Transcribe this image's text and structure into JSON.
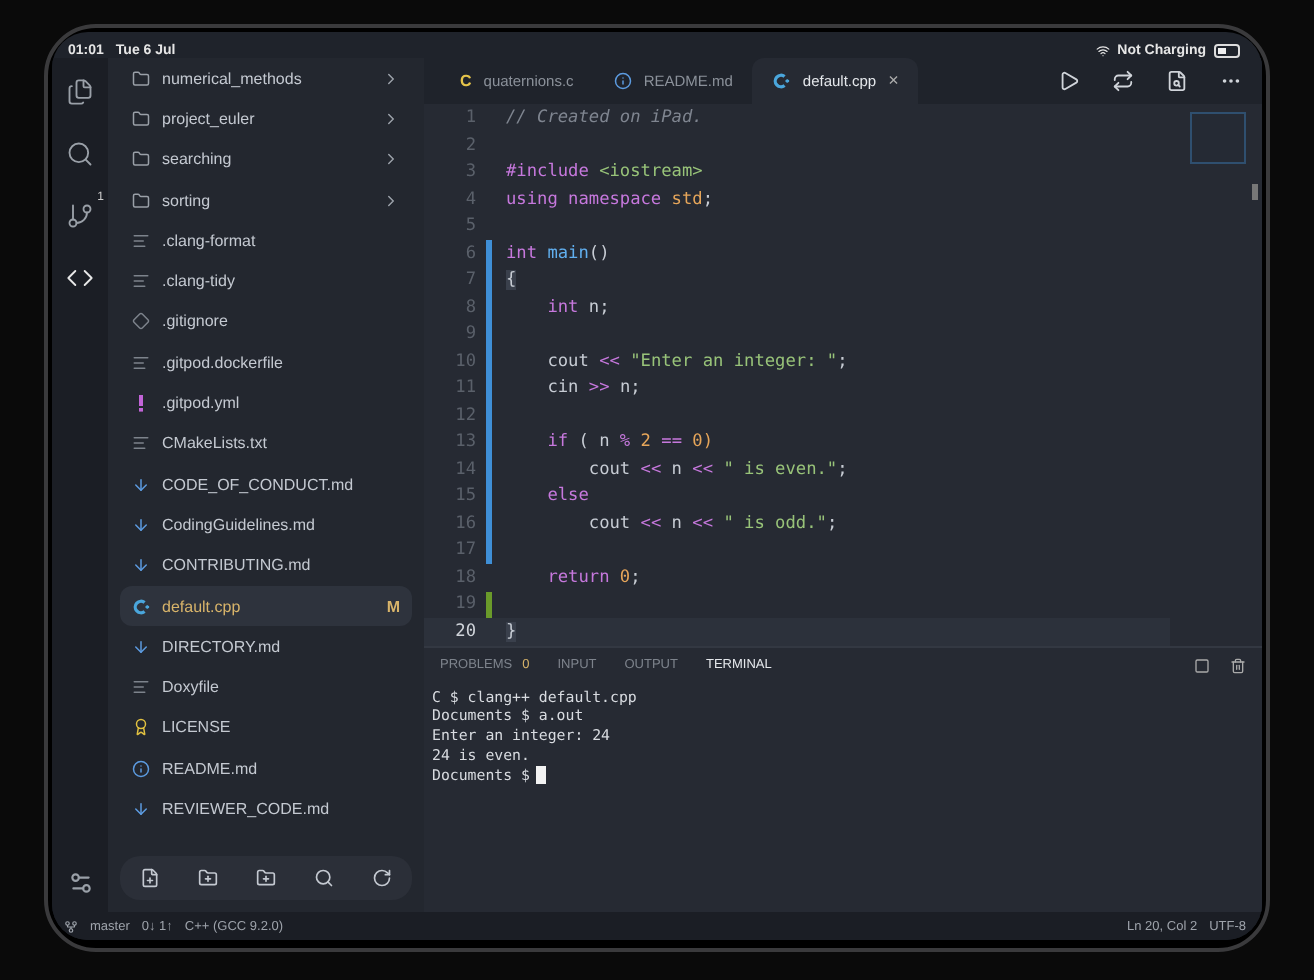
{
  "status_bar_top": {
    "time": "01:01",
    "date": "Tue 6 Jul",
    "battery_text": "Not Charging"
  },
  "activity_bar": {
    "items": [
      {
        "selected": false
      },
      {
        "selected": false
      },
      {
        "selected": false,
        "badge": "1"
      },
      {
        "selected": true
      }
    ]
  },
  "sidebar": {
    "items": [
      {
        "name": "numerical_methods",
        "kind": "folder"
      },
      {
        "name": "project_euler",
        "kind": "folder"
      },
      {
        "name": "searching",
        "kind": "folder"
      },
      {
        "name": "sorting",
        "kind": "folder"
      },
      {
        "name": ".clang-format",
        "kind": "text",
        "selected": false
      },
      {
        "name": ".clang-tidy",
        "kind": "text",
        "selected": false
      },
      {
        "name": ".gitignore",
        "kind": "git",
        "selected": false
      },
      {
        "name": ".gitpod.dockerfile",
        "kind": "text",
        "selected": false
      },
      {
        "name": ".gitpod.yml",
        "kind": "yaml",
        "selected": false
      },
      {
        "name": "CMakeLists.txt",
        "kind": "text",
        "selected": false
      },
      {
        "name": "CODE_OF_CONDUCT.md",
        "kind": "markdown",
        "selected": false
      },
      {
        "name": "CodingGuidelines.md",
        "kind": "markdown",
        "selected": false
      },
      {
        "name": "CONTRIBUTING.md",
        "kind": "markdown",
        "selected": false
      },
      {
        "name": "default.cpp",
        "kind": "cpp",
        "selected": true,
        "badge": "M"
      },
      {
        "name": "DIRECTORY.md",
        "kind": "markdown",
        "selected": false
      },
      {
        "name": "Doxyfile",
        "kind": "text",
        "selected": false
      },
      {
        "name": "LICENSE",
        "kind": "license",
        "selected": false
      },
      {
        "name": "README.md",
        "kind": "info",
        "selected": false
      },
      {
        "name": "REVIEWER_CODE.md",
        "kind": "markdown",
        "selected": false
      }
    ]
  },
  "editor_tabs": [
    {
      "label": "quaternions.c",
      "kind": "c",
      "icon_text": "C",
      "selected": false
    },
    {
      "label": "README.md",
      "kind": "info",
      "selected": false
    },
    {
      "label": "default.cpp",
      "kind": "cpp",
      "selected": true,
      "close": "×"
    }
  ],
  "code_lines": [
    {
      "number": "1",
      "modified": false,
      "added": false,
      "current": false,
      "tokens": [
        {
          "text": "// Created on iPad.",
          "kind": "comment"
        }
      ]
    },
    {
      "number": "2",
      "modified": false,
      "added": false,
      "current": false
    },
    {
      "number": "3",
      "modified": false,
      "added": false,
      "current": false,
      "tokens": [
        {
          "text": "#include ",
          "kind": "keyword"
        },
        {
          "text": "<iostream>",
          "kind": "string"
        }
      ]
    },
    {
      "number": "4",
      "modified": false,
      "added": false,
      "current": false,
      "tokens": [
        {
          "text": "using namespace ",
          "kind": "keyword"
        },
        {
          "text": "std",
          "kind": "type"
        },
        {
          "text": ";",
          "kind": "plain"
        }
      ]
    },
    {
      "number": "5",
      "modified": false,
      "added": false,
      "current": false
    },
    {
      "number": "6",
      "modified": true,
      "added": false,
      "current": false,
      "tokens": [
        {
          "text": "int ",
          "kind": "keyword"
        },
        {
          "text": "main",
          "kind": "func"
        },
        {
          "text": "()",
          "kind": "plain"
        }
      ]
    },
    {
      "number": "7",
      "modified": true,
      "added": false,
      "current": false,
      "tokens": [
        {
          "text": "{",
          "kind": "bracket"
        }
      ]
    },
    {
      "number": "8",
      "modified": true,
      "added": false,
      "current": false,
      "tokens": [
        {
          "text": "    int ",
          "kind": "keyword"
        },
        {
          "text": "n;",
          "kind": "plain"
        }
      ]
    },
    {
      "number": "9",
      "modified": true,
      "added": false,
      "current": false
    },
    {
      "number": "10",
      "modified": true,
      "added": false,
      "current": false,
      "tokens": [
        {
          "text": "    cout ",
          "kind": "plain"
        },
        {
          "text": "<< ",
          "kind": "keyword"
        },
        {
          "text": "\"Enter an integer: \"",
          "kind": "string"
        },
        {
          "text": ";",
          "kind": "plain"
        }
      ]
    },
    {
      "number": "11",
      "modified": true,
      "added": false,
      "current": false,
      "tokens": [
        {
          "text": "    cin ",
          "kind": "plain"
        },
        {
          "text": ">> ",
          "kind": "keyword"
        },
        {
          "text": "n;",
          "kind": "plain"
        }
      ]
    },
    {
      "number": "12",
      "modified": true,
      "added": false,
      "current": false
    },
    {
      "number": "13",
      "modified": true,
      "added": false,
      "current": false,
      "tokens": [
        {
          "text": "    if ",
          "kind": "keyword"
        },
        {
          "text": "( n ",
          "kind": "plain"
        },
        {
          "text": "% ",
          "kind": "keyword"
        },
        {
          "text": "2 ",
          "kind": "number"
        },
        {
          "text": "== ",
          "kind": "keyword"
        },
        {
          "text": "0)",
          "kind": "number"
        }
      ]
    },
    {
      "number": "14",
      "modified": true,
      "added": false,
      "current": false,
      "tokens": [
        {
          "text": "        cout ",
          "kind": "plain"
        },
        {
          "text": "<< ",
          "kind": "keyword"
        },
        {
          "text": "n ",
          "kind": "plain"
        },
        {
          "text": "<< ",
          "kind": "keyword"
        },
        {
          "text": "\" is even.\"",
          "kind": "string"
        },
        {
          "text": ";",
          "kind": "plain"
        }
      ]
    },
    {
      "number": "15",
      "modified": true,
      "added": false,
      "current": false,
      "tokens": [
        {
          "text": "    else",
          "kind": "keyword"
        }
      ]
    },
    {
      "number": "16",
      "modified": true,
      "added": false,
      "current": false,
      "tokens": [
        {
          "text": "        cout ",
          "kind": "plain"
        },
        {
          "text": "<< ",
          "kind": "keyword"
        },
        {
          "text": "n ",
          "kind": "plain"
        },
        {
          "text": "<< ",
          "kind": "keyword"
        },
        {
          "text": "\" is odd.\"",
          "kind": "string"
        },
        {
          "text": ";",
          "kind": "plain"
        }
      ]
    },
    {
      "number": "17",
      "modified": true,
      "added": false,
      "current": false
    },
    {
      "number": "18",
      "modified": false,
      "added": false,
      "current": false,
      "tokens": [
        {
          "text": "    return ",
          "kind": "keyword"
        },
        {
          "text": "0",
          "kind": "number"
        },
        {
          "text": ";",
          "kind": "plain"
        }
      ]
    },
    {
      "number": "19",
      "modified": false,
      "added": true,
      "current": false
    },
    {
      "number": "20",
      "modified": false,
      "added": false,
      "current": true,
      "tokens": [
        {
          "text": "}",
          "kind": "bracket"
        }
      ]
    }
  ],
  "panel": {
    "tabs": [
      {
        "label": "PROBLEMS",
        "count": "0",
        "selected": false
      },
      {
        "label": "INPUT",
        "selected": false
      },
      {
        "label": "OUTPUT",
        "selected": false
      },
      {
        "label": "TERMINAL",
        "selected": true
      }
    ],
    "terminal_lines": [
      "C $ clang++ default.cpp",
      "Documents $ a.out",
      "Enter an integer: 24",
      "24 is even.",
      "Documents $"
    ]
  },
  "status_bar": {
    "branch": "master",
    "sync": "0↓ 1↑",
    "language": "C++ (GCC 9.2.0)",
    "position": "Ln 20, Col 2",
    "encoding": "UTF-8"
  }
}
